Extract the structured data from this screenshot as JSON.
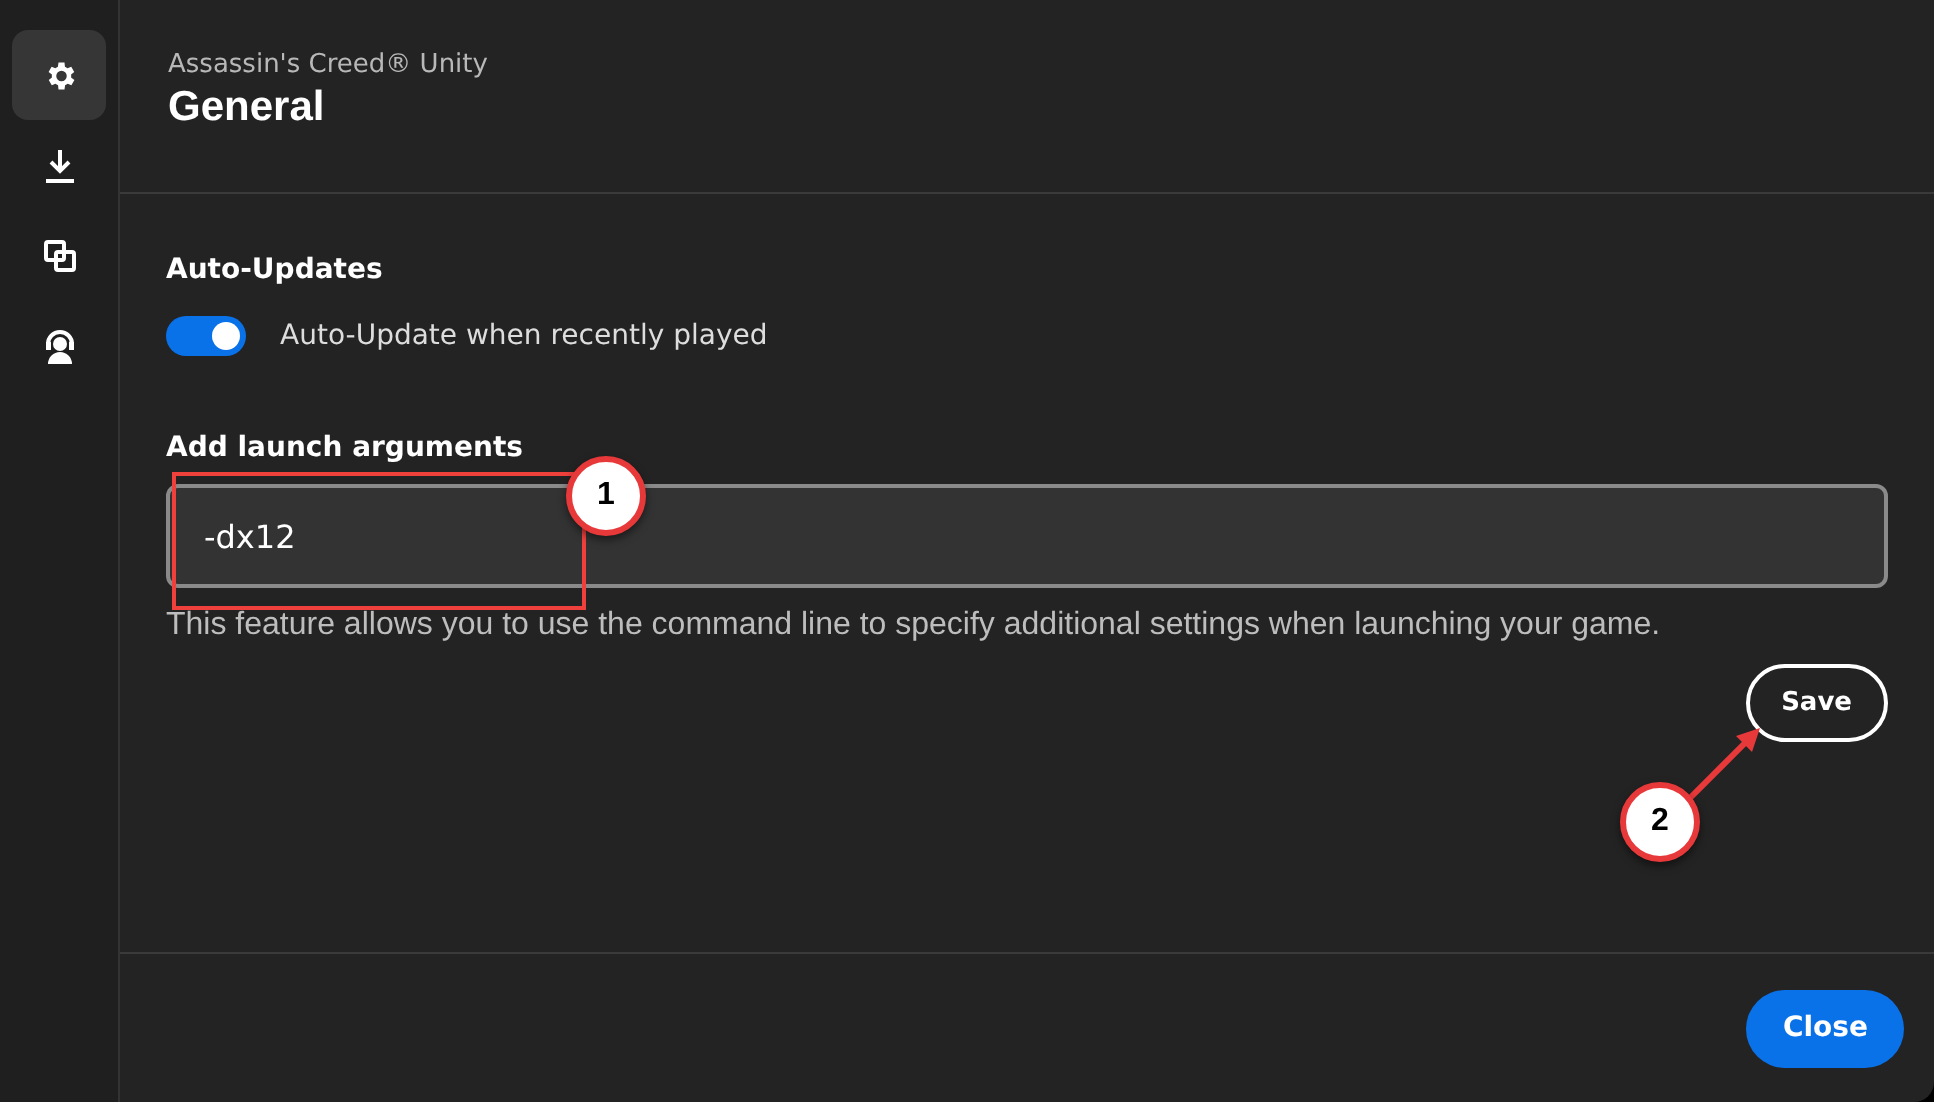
{
  "sidebar": {
    "items": [
      {
        "selected": true
      },
      {
        "selected": false
      },
      {
        "selected": false
      },
      {
        "selected": false
      }
    ]
  },
  "header": {
    "subtitle": "Assassin's Creed® Unity",
    "title": "General"
  },
  "auto_updates": {
    "heading": "Auto-Updates",
    "toggle": {
      "label": "Auto-Update when recently played",
      "on": true
    }
  },
  "launch_arguments": {
    "heading": "Add launch arguments",
    "value": "-dx12",
    "help": "This feature allows you to use the command line to specify additional settings when launching your game.",
    "save_button": "Save"
  },
  "footer": {
    "close_button": "Close"
  },
  "callouts": [
    {
      "label": "1"
    },
    {
      "label": "2"
    }
  ]
}
